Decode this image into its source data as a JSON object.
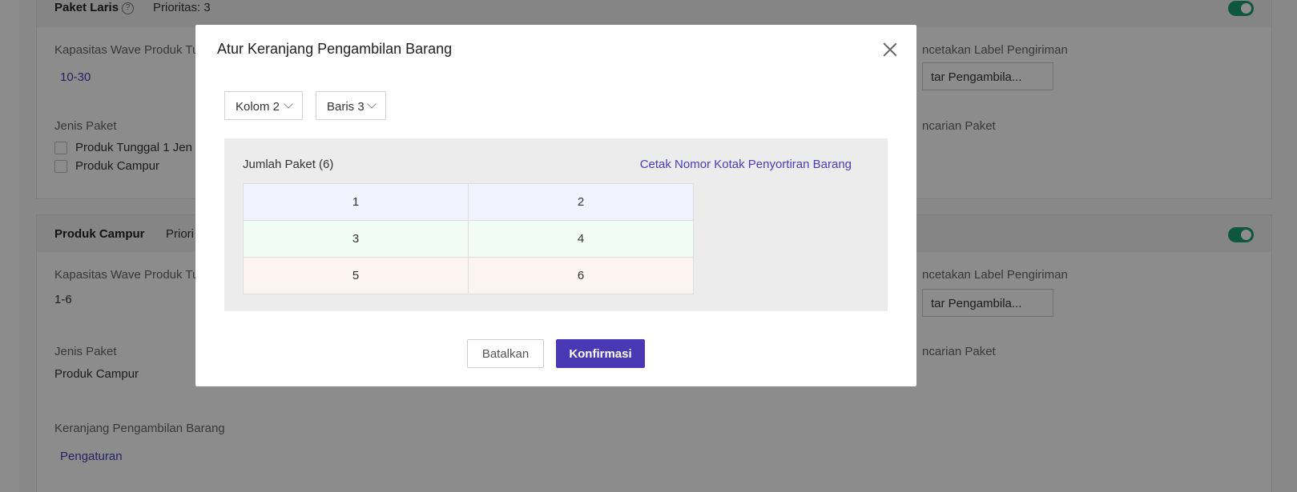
{
  "background": {
    "card1": {
      "title": "Paket Laris",
      "priority": "Prioritas: 3",
      "wave_label": "Kapasitas Wave Produk Tu",
      "wave_value": "10-30",
      "type_label": "Jenis Paket",
      "opt1": "Produk Tunggal 1 Jen",
      "opt2": "Produk Campur",
      "print_label": "ncetakan Label Pengiriman",
      "print_select": "tar Pengambila...",
      "search_label": "ncarian Paket"
    },
    "card2": {
      "title": "Produk Campur",
      "priority": "Priori",
      "wave_label": "Kapasitas Wave Produk Tu",
      "wave_value": "1-6",
      "type_label": "Jenis Paket",
      "type_value": "Produk Campur",
      "print_label": "ncetakan Label Pengiriman",
      "print_select": "tar Pengambila...",
      "search_label": "ncarian Paket",
      "basket_label": "Keranjang Pengambilan Barang",
      "basket_link": "Pengaturan"
    }
  },
  "modal": {
    "title": "Atur Keranjang Pengambilan Barang",
    "column_select": "Kolom 2",
    "row_select": "Baris 3",
    "package_count": "Jumlah Paket (6)",
    "print_link": "Cetak Nomor Kotak Penyortiran Barang",
    "grid": [
      [
        "1",
        "2"
      ],
      [
        "3",
        "4"
      ],
      [
        "5",
        "6"
      ]
    ],
    "row_colors": [
      "#f0f2fd",
      "#f1fcf4",
      "#fdf3f1"
    ],
    "cancel_label": "Batalkan",
    "confirm_label": "Konfirmasi"
  },
  "colors": {
    "accent": "#4a37b3",
    "toggle": "#1a9e73"
  }
}
